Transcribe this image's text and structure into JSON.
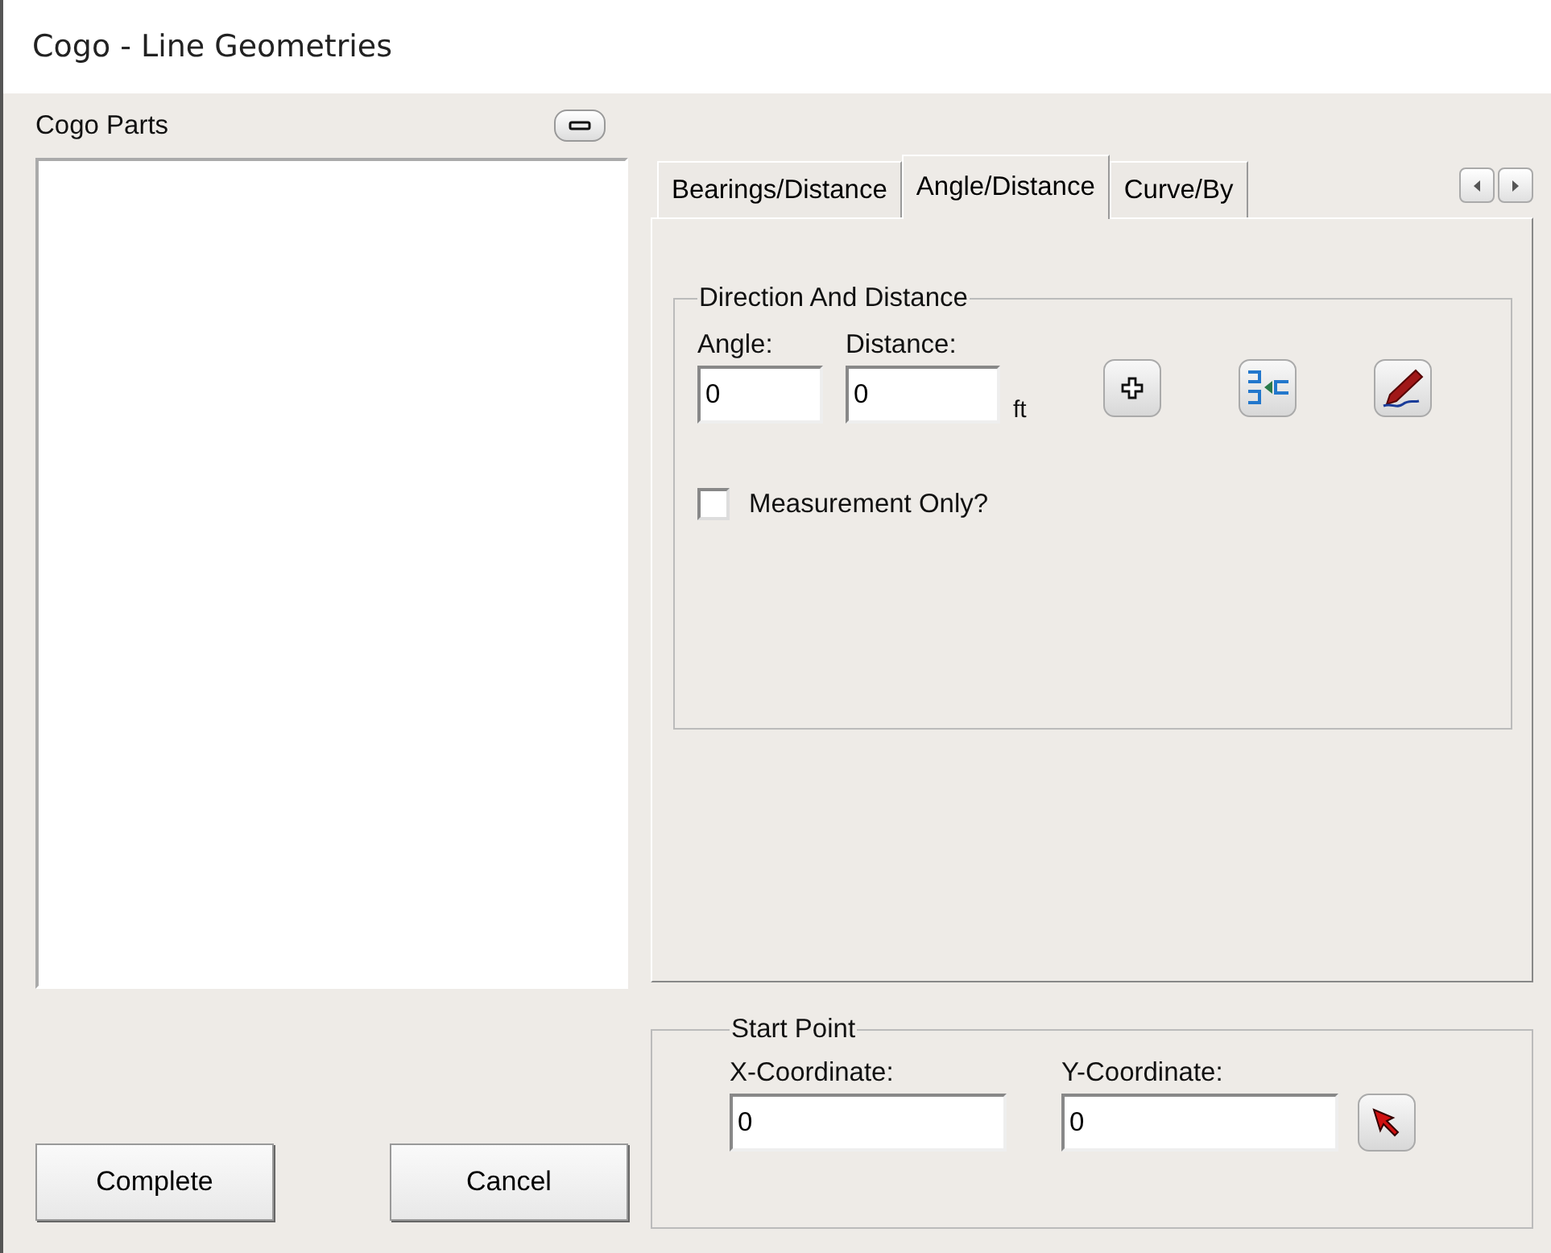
{
  "window": {
    "title": "Cogo - Line Geometries"
  },
  "cogo_parts": {
    "label": "Cogo Parts"
  },
  "tabs": [
    {
      "label": "Bearings/Distance",
      "selected": false
    },
    {
      "label": "Angle/Distance",
      "selected": true
    },
    {
      "label": "Curve/By",
      "selected": false
    }
  ],
  "direction_group": {
    "title": "Direction And Distance",
    "angle": {
      "label": "Angle:",
      "value": "0"
    },
    "distance": {
      "label": "Distance:",
      "value": "0",
      "unit": "ft"
    },
    "measurement_only": {
      "label": "Measurement Only?",
      "checked": false
    }
  },
  "start_point": {
    "title": "Start Point",
    "x": {
      "label": "X-Coordinate:",
      "value": "0"
    },
    "y": {
      "label": "Y-Coordinate:",
      "value": "0"
    }
  },
  "buttons": [
    "Complete",
    "Cancel"
  ]
}
